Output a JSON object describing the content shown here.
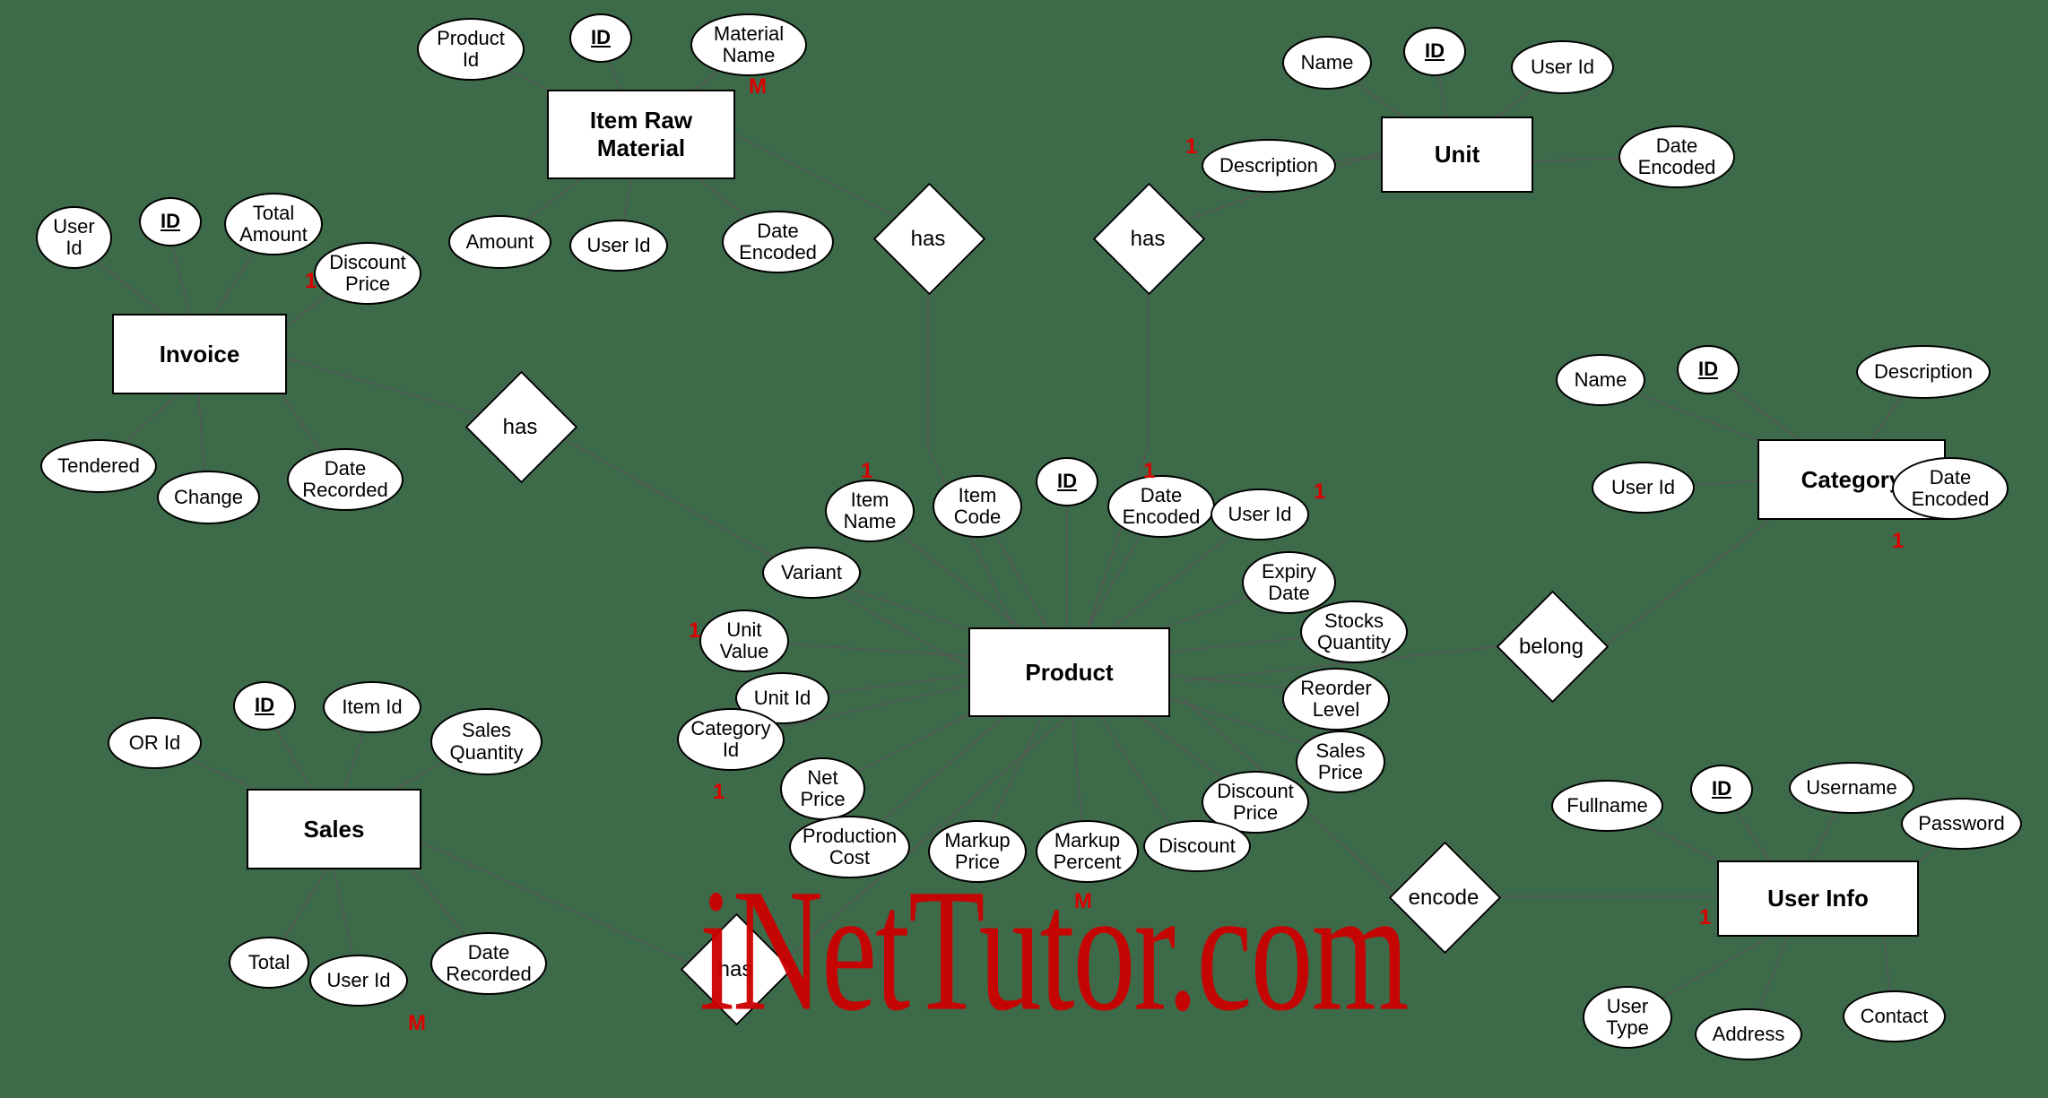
{
  "watermark": "iNetTutor.com",
  "entities": {
    "itemRawMaterial": {
      "label": "Item Raw\nMaterial",
      "attrs": {
        "productId": "Product\nId",
        "id": "ID",
        "materialName": "Material\nName",
        "amount": "Amount",
        "userId": "User Id",
        "dateEncoded": "Date\nEncoded"
      }
    },
    "unit": {
      "label": "Unit",
      "attrs": {
        "name": "Name",
        "id": "ID",
        "userId": "User Id",
        "description": "Description",
        "dateEncoded": "Date\nEncoded"
      }
    },
    "invoice": {
      "label": "Invoice",
      "attrs": {
        "userId": "User\nId",
        "id": "ID",
        "totalAmount": "Total\nAmount",
        "discountPrice": "Discount\nPrice",
        "tendered": "Tendered",
        "change": "Change",
        "dateRecorded": "Date\nRecorded"
      }
    },
    "category": {
      "label": "Category",
      "attrs": {
        "name": "Name",
        "id": "ID",
        "description": "Description",
        "userId": "User Id",
        "dateEncoded": "Date\nEncoded"
      }
    },
    "product": {
      "label": "Product",
      "attrs": {
        "id": "ID",
        "itemName": "Item\nName",
        "itemCode": "Item\nCode",
        "dateEncoded": "Date\nEncoded",
        "userId": "User Id",
        "variant": "Variant",
        "expiryDate": "Expiry\nDate",
        "unitValue": "Unit\nValue",
        "stocksQuantity": "Stocks\nQuantity",
        "unitId": "Unit Id",
        "reorderLevel": "Reorder\nLevel",
        "categoryId": "Category\nId",
        "salesPrice": "Sales\nPrice",
        "netPrice": "Net\nPrice",
        "discountPrice": "Discount\nPrice",
        "productionCost": "Production\nCost",
        "markupPrice": "Markup\nPrice",
        "markupPercent": "Markup\nPercent",
        "discount": "Discount"
      }
    },
    "sales": {
      "label": "Sales",
      "attrs": {
        "id": "ID",
        "itemId": "Item Id",
        "orId": "OR Id",
        "salesQuantity": "Sales\nQuantity",
        "total": "Total",
        "userId": "User Id",
        "dateRecorded": "Date\nRecorded"
      }
    },
    "userInfo": {
      "label": "User Info",
      "attrs": {
        "fullname": "Fullname",
        "id": "ID",
        "username": "Username",
        "password": "Password",
        "userType": "User\nType",
        "address": "Address",
        "contact": "Contact"
      }
    }
  },
  "relationships": {
    "has1": "has",
    "has2": "has",
    "has3": "has",
    "has4": "has",
    "belong": "belong",
    "encode": "encode"
  },
  "cardinalities": {
    "itemRawMaterial_M": "M",
    "invoice_1": "1",
    "unit_1": "1",
    "product_itemName_1": "1",
    "product_dateEncoded_1": "1",
    "product_userId_1": "1",
    "product_unitValue_1": "1",
    "product_categoryId_1": "1",
    "product_markupPercent_M": "M",
    "category_1": "1",
    "sales_M": "M",
    "userInfo_1": "1"
  }
}
